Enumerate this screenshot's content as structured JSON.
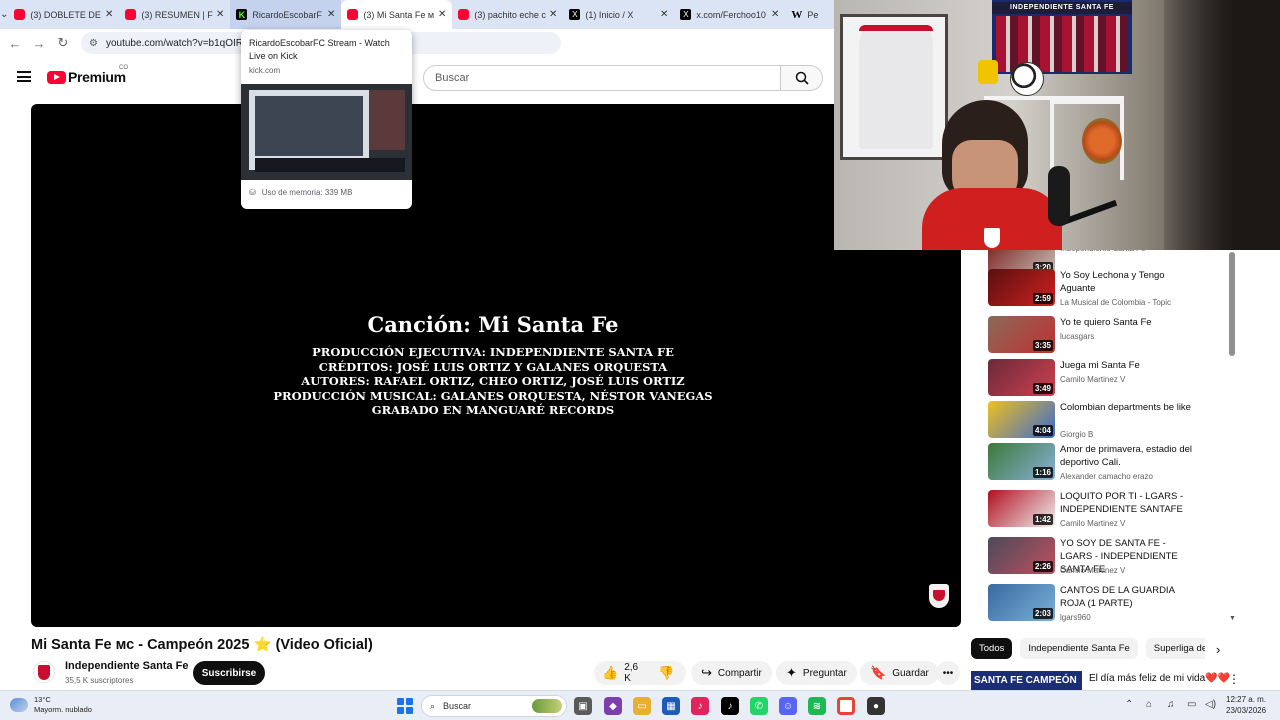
{
  "browser": {
    "tabs": [
      {
        "title": "(3) DOBLETE DE C",
        "icon": "youtube-favicon",
        "state": "normal"
      },
      {
        "title": "(3) RESUMEN | FC",
        "icon": "youtube-favicon",
        "state": "normal"
      },
      {
        "title": "RicardoEscobarF",
        "icon": "kick-favicon",
        "state": "hover"
      },
      {
        "title": "(3) Mi Santa Fe м",
        "icon": "youtube-favicon",
        "state": "active"
      },
      {
        "title": "(3) pachito eche c",
        "icon": "youtube-favicon",
        "state": "normal"
      },
      {
        "title": "(1) Inicio / X",
        "icon": "x-favicon",
        "state": "normal"
      },
      {
        "title": "x.com/Ferchoo10",
        "icon": "x-favicon",
        "state": "normal"
      },
      {
        "title": "Pe",
        "icon": "wikipedia-favicon",
        "state": "normal"
      }
    ],
    "url": "youtube.com/watch?v=b1qOIRE3",
    "url_tail": "1",
    "hover_card": {
      "title": "RicardoEscobarFC Stream - Watch Live on Kick",
      "domain": "kick.com",
      "memory": "Uso de memoria: 339 MB"
    }
  },
  "youtube": {
    "brand": "Premium",
    "country": "CO",
    "search_placeholder": "Buscar"
  },
  "player": {
    "song_title": "Canción: Mi Santa Fe",
    "credit_lines": [
      "PRODUCCIÓN EJECUTIVA: INDEPENDIENTE SANTA FE",
      "CRÉDITOS: JOSÉ LUIS ORTIZ Y GALANES ORQUESTA",
      "AUTORES: RAFAEL ORTIZ, CHEO ORTIZ, JOSÉ LUIS ORTIZ",
      "PRODUCCIÓN MUSICAL: GALANES ORQUESTA, NÉSTOR VANEGAS",
      "GRABADO EN MANGUARÉ RECORDS"
    ]
  },
  "video": {
    "title": "Mi Santa Fe мс - Campeón 2025",
    "title_emoji": "⭐",
    "title_suffix": "(Video Oficial)",
    "channel": "Independiente Santa Fe",
    "subscribers": "35,5 K suscriptores",
    "subscribe_label": "Suscribirse",
    "likes": "2,6 K",
    "share_label": "Compartir",
    "ask_label": "Preguntar",
    "save_label": "Guardar"
  },
  "recommendations": [
    {
      "title": "",
      "channel": "Independiente Santa Fe",
      "duration": "3:20",
      "thumb_colors": [
        "#7a1a1a",
        "#c8c0b8"
      ]
    },
    {
      "title": "Yo Soy Lechona y Tengo Aguante",
      "channel": "La Musical de Colombia - Topic",
      "duration": "2:59",
      "thumb_colors": [
        "#5a1010",
        "#d02020"
      ]
    },
    {
      "title": "Yo te quiero Santa Fe",
      "channel": "lucasgars",
      "duration": "3:35",
      "thumb_colors": [
        "#8a6a5a",
        "#c03030"
      ]
    },
    {
      "title": "Juega mi Santa Fe",
      "channel": "Camilo Martinez V",
      "duration": "3:49",
      "thumb_colors": [
        "#6a2a3a",
        "#d04050"
      ]
    },
    {
      "title": "Colombian departments be like",
      "channel": "Giorgio B",
      "duration": "4:04",
      "thumb_colors": [
        "#f0c020",
        "#3a6ad0"
      ]
    },
    {
      "title": "Amor de primavera, estadio del deportivo Cali.",
      "channel": "Alexander camacho erazo",
      "duration": "1:16",
      "thumb_colors": [
        "#3a7a3a",
        "#8ab0d8"
      ]
    },
    {
      "title": "LOQUITO POR TI - LGARS - INDEPENDIENTE SANTAFE",
      "channel": "Camilo Martinez V",
      "duration": "1:42",
      "thumb_colors": [
        "#b01020",
        "#f0f0f0"
      ]
    },
    {
      "title": "YO SOY DE SANTA FE - LGARS - INDEPENDIENTE SANTA FE",
      "channel": "Camilo Martinez V",
      "duration": "2:26",
      "thumb_colors": [
        "#4a4a5a",
        "#c05060"
      ]
    },
    {
      "title": "CANTOS DE LA GUARDIA ROJA (1 PARTE)",
      "channel": "lgars960",
      "duration": "2:03",
      "thumb_colors": [
        "#3a6aa0",
        "#7ab0d8"
      ]
    }
  ],
  "chips": [
    {
      "label": "Todos",
      "selected": true
    },
    {
      "label": "Independiente Santa Fe",
      "selected": false
    },
    {
      "label": "Superliga de C",
      "selected": false
    }
  ],
  "next_rec": {
    "thumb_text": "SANTA FE CAMPEÓN",
    "title": "El día más feliz de mi vida❤️❤️"
  },
  "taskbar": {
    "temperature": "13°C",
    "weather": "Mayorm. nublado",
    "search_label": "Buscar",
    "time": "12:27 a. m.",
    "date": "23/03/2026"
  },
  "webcam": {
    "poster_banner": "INDEPENDIENTE SANTA FE"
  }
}
